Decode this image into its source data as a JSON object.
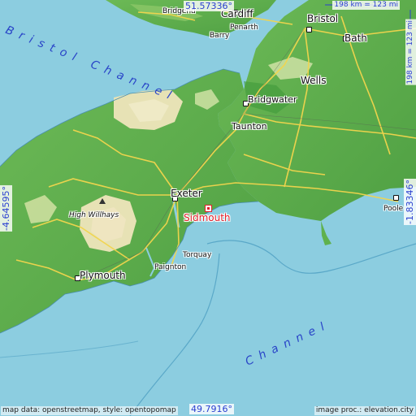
{
  "map": {
    "focus_place": "Sidmouth",
    "cities": [
      "Cardiff",
      "Bristol",
      "Bath",
      "Wells",
      "Bridgwater",
      "Taunton",
      "Exeter",
      "Plymouth",
      "Torquay",
      "Paignton",
      "Poole",
      "Barry",
      "Penarth",
      "Bridgend"
    ],
    "peak": "High Willhays",
    "water": {
      "bristol_channel": "Bristol Channel",
      "english_channel": "Channel"
    },
    "coordinates": {
      "north": "51.57336°",
      "south": "49.7916°",
      "west": "-4.64595°",
      "east": "-1.83346°"
    },
    "scale": {
      "horizontal": "198 km = 123 mi",
      "vertical": "198 km = 123 mi"
    },
    "credits": {
      "left": "map data: openstreetmap, style: opentopomap",
      "right": "image proc.: elevation.city"
    },
    "colors": {
      "sea": "#8ccde0",
      "lowland": "#5fb14d",
      "upland": "#e7e2b5",
      "road": "#f2d54d",
      "marker": "#e0202a",
      "coord_text": "#2a3fd0"
    }
  }
}
